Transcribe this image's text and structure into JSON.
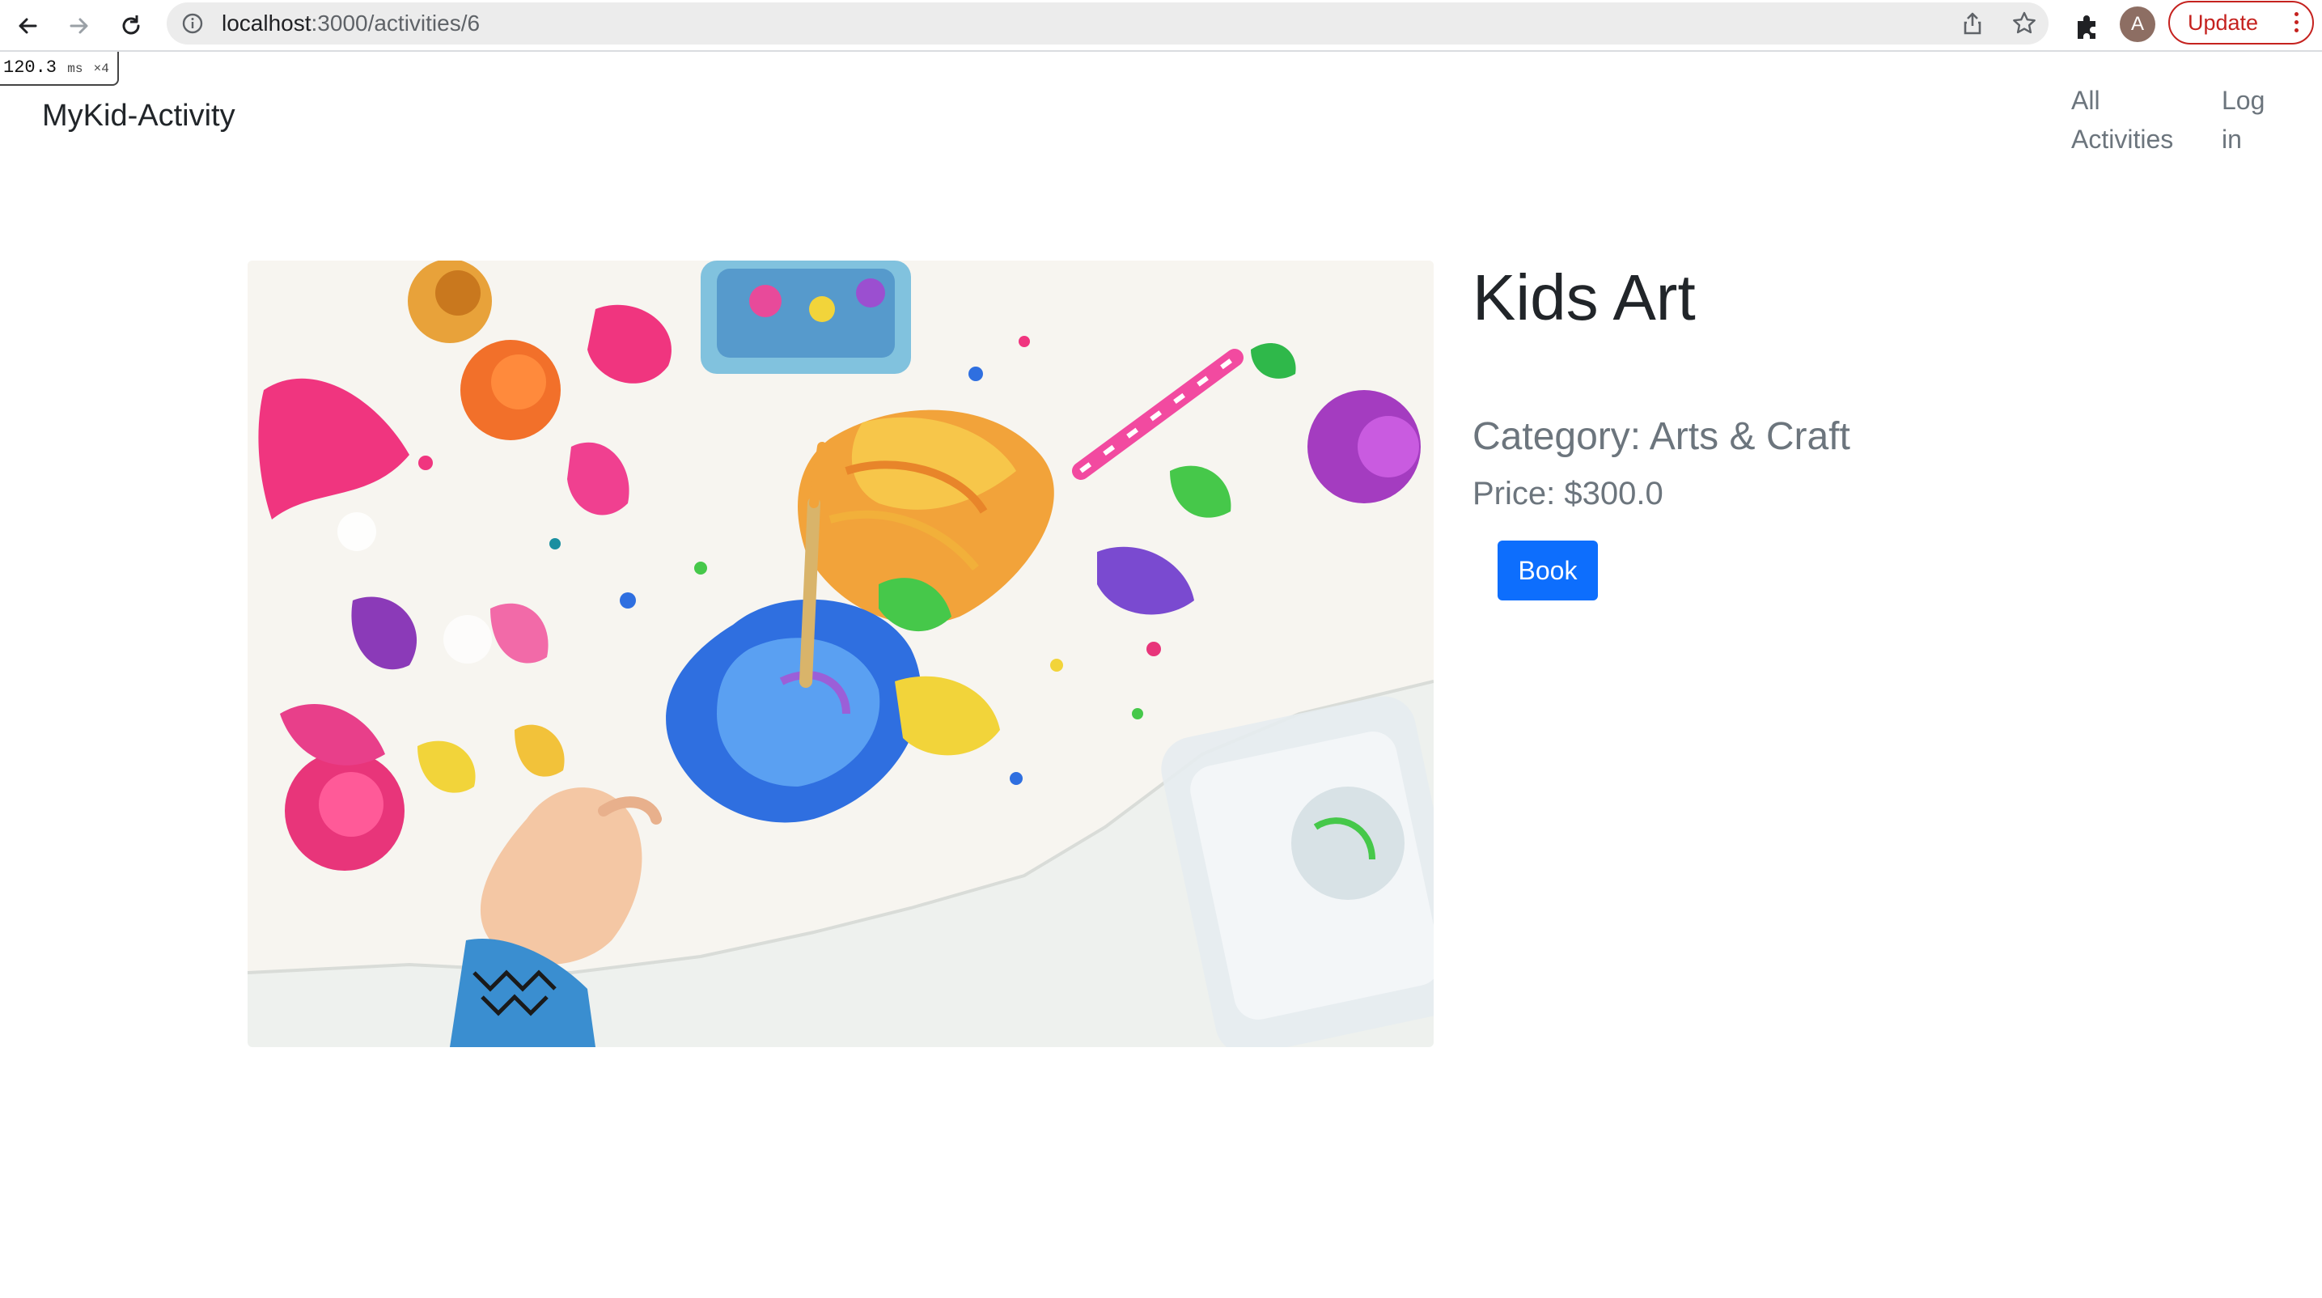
{
  "browser": {
    "url_host": "localhost",
    "url_path": ":3000/activities/6",
    "avatar_letter": "A",
    "update_label": "Update",
    "perf_time": "120.3",
    "perf_unit": "ms",
    "perf_multiplier": "×4"
  },
  "navbar": {
    "brand": "MyKid-Activity",
    "links": [
      {
        "line1": "All",
        "line2": "Activities"
      },
      {
        "line1": "Log",
        "line2": "in"
      }
    ]
  },
  "activity": {
    "title": "Kids Art",
    "category_label": "Category: Arts & Craft",
    "price_label": "Price: $300.0",
    "book_label": "Book"
  },
  "colors": {
    "primary": "#0d6efd",
    "muted": "#6c757d",
    "update_red": "#c5221f"
  }
}
